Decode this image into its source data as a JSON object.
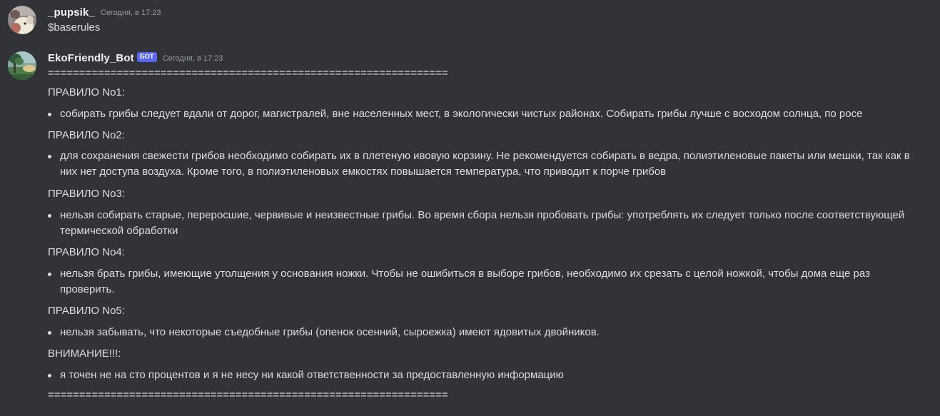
{
  "messages": [
    {
      "author": "_pupsik_",
      "timestamp": "Сегодня, в 17:23",
      "content": "$baserules"
    },
    {
      "author": "EkoFriendly_Bot",
      "tag": "БОТ",
      "timestamp": "Сегодня, в 17:23",
      "separator_top": "================================================================",
      "rules": [
        {
          "title": "ПРАВИЛО No1:",
          "text": "собирать грибы следует вдали от дорог, магистралей, вне населенных мест, в экологически чистых районах. Собирать грибы лучше с восходом солнца, по росе"
        },
        {
          "title": "ПРАВИЛО No2:",
          "text": "для сохранения свежести грибов необходимо собирать их в плетеную ивовую корзину. Не рекомендуется собирать в ведра, полиэтиленовые пакеты или мешки, так как в них нет доступа воздуха. Кроме того, в полиэтиленовых емкостях повышается температура, что приводит к порче грибов"
        },
        {
          "title": "ПРАВИЛО No3:",
          "text": "нельзя собирать старые, переросшие, червивые и неизвестные грибы. Во время сбора нельзя пробовать грибы: употреблять их следует только после соответствующей термической обработки"
        },
        {
          "title": "ПРАВИЛО No4:",
          "text": "нельзя брать грибы, имеющие утолщения у основания ножки. Чтобы не ошибиться в выборе грибов, необходимо их срезать с целой ножкой, чтобы дома еще раз проверить."
        },
        {
          "title": "ПРАВИЛО No5:",
          "text": "нельзя забывать, что некоторые съедобные грибы (опенок осенний, сыроежка) имеют ядовитых двойников."
        },
        {
          "title": "ВНИМАНИЕ!!!:",
          "text": "я точен не на сто  процентов и я не несу ни какой ответственности за предоставленную информацию"
        }
      ],
      "separator_bottom": "================================================================"
    }
  ],
  "colors": {
    "background": "#313338",
    "text": "#dbdee1",
    "username": "#f2f3f5",
    "timestamp": "#949ba4",
    "bot_tag": "#5865f2"
  }
}
